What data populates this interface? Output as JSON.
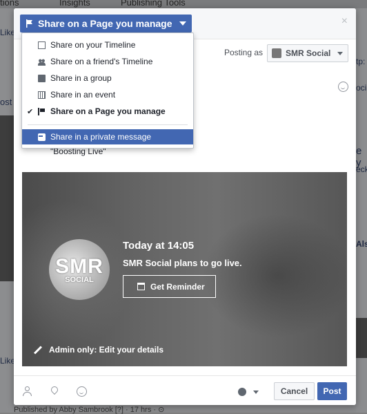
{
  "background": {
    "top_items": [
      "tions",
      "Insights",
      "Publishing Tools"
    ],
    "left_snippets": [
      "Like",
      "ost",
      "Like"
    ],
    "right_snippets": [
      "tp:",
      "ocia",
      "e y",
      "eck",
      "Also"
    ],
    "bottom_text": "Published by Abby Sambrook [?] · 17 hrs · ⊙"
  },
  "dialog": {
    "share_button_label": "Share on a Page you manage",
    "close_label": "×",
    "posting_as_label": "Posting as",
    "page_name": "SMR Social",
    "quote_text": "\"Boosting Live\""
  },
  "menu": {
    "items": [
      {
        "label": "Share on your Timeline",
        "icon": "edit-icon"
      },
      {
        "label": "Share on a friend's Timeline",
        "icon": "friends-icon"
      },
      {
        "label": "Share in a group",
        "icon": "group-icon"
      },
      {
        "label": "Share in an event",
        "icon": "event-icon"
      },
      {
        "label": "Share on a Page you manage",
        "icon": "flag-icon",
        "checked": true
      },
      {
        "label": "Share in a private message",
        "icon": "message-icon",
        "highlighted": true
      }
    ],
    "check_mark": "✔"
  },
  "video": {
    "logo_main": "SMR",
    "logo_sub": "SOCIAL",
    "time": "Today at 14:05",
    "description": "SMR Social plans to go live.",
    "reminder_label": "Get Reminder",
    "edit_label": "Admin only: Edit your details"
  },
  "footer": {
    "cancel_label": "Cancel",
    "post_label": "Post"
  },
  "colors": {
    "accent": "#4267b2",
    "overlay": "#8a8b8d"
  }
}
